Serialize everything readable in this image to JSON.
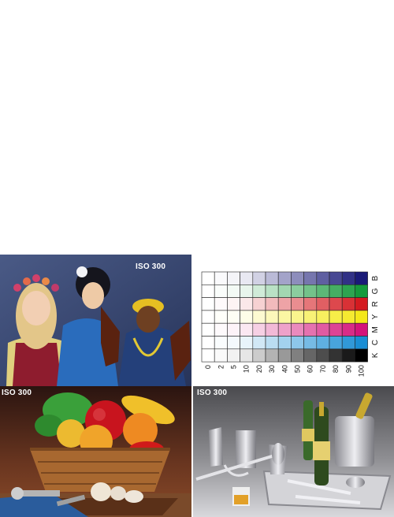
{
  "panels": {
    "portrait": {
      "iso_label": "ISO 300"
    },
    "fruit": {
      "iso_label": "ISO 300"
    },
    "silverware": {
      "iso_label": "ISO 300"
    }
  },
  "chart_data": {
    "type": "table",
    "columns": [
      "0",
      "2",
      "5",
      "10",
      "20",
      "30",
      "40",
      "50",
      "60",
      "70",
      "80",
      "90",
      "100"
    ],
    "rows": [
      "B",
      "G",
      "R",
      "Y",
      "M",
      "C",
      "K"
    ],
    "full_colors": {
      "B": "#1a1a78",
      "G": "#169a3c",
      "R": "#d41a20",
      "Y": "#f4e81a",
      "M": "#d4147a",
      "C": "#1a8ed4",
      "K": "#000000"
    }
  }
}
